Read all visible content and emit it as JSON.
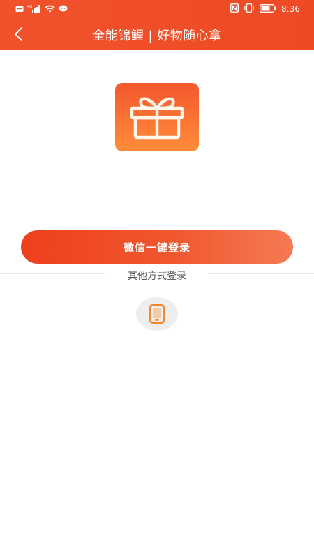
{
  "status_bar": {
    "time": "8:36",
    "network": "4G",
    "left_icons": [
      "sms-icon",
      "signal-icon",
      "wifi-icon",
      "chat-icon"
    ],
    "right_icons": [
      "nfc-icon",
      "vibrate-icon",
      "battery-icon"
    ]
  },
  "navbar": {
    "title": "全能锦鲤 | 好物随心拿",
    "back_icon": "chevron-left-icon"
  },
  "logo": {
    "icon": "gift-icon"
  },
  "login": {
    "wechat_button_label": "微信一键登录",
    "other_methods_label": "其他方式登录",
    "phone_login_icon": "smartphone-icon"
  },
  "colors": {
    "primary": "#f0522c",
    "button_start": "#ef3f1c",
    "button_end": "#f67a52",
    "logo_top": "#f4582e",
    "logo_bottom": "#ff8c3a",
    "phone_icon": "#f5862c"
  }
}
